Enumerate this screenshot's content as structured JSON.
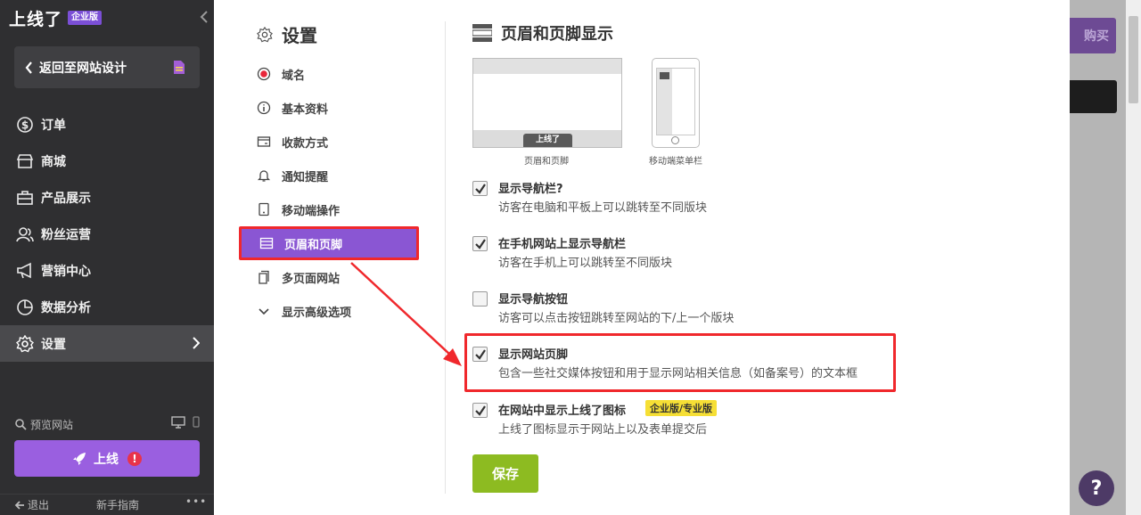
{
  "sidebar": {
    "logo": "上线了",
    "edition_badge": "企业版",
    "back_label": "返回至网站设计",
    "items": [
      {
        "label": "订单",
        "icon": "dollar-circle-icon"
      },
      {
        "label": "商城",
        "icon": "store-icon"
      },
      {
        "label": "产品展示",
        "icon": "briefcase-icon"
      },
      {
        "label": "粉丝运营",
        "icon": "users-icon"
      },
      {
        "label": "营销中心",
        "icon": "megaphone-icon"
      },
      {
        "label": "数据分析",
        "icon": "pie-chart-icon"
      },
      {
        "label": "设置",
        "icon": "gear-icon"
      }
    ],
    "active_item": "设置",
    "preview_label": "预览网站",
    "publish_label": "上线",
    "publish_warning": "!",
    "logout_label": "退出",
    "guide_label": "新手指南",
    "more_label": "•••"
  },
  "background": {
    "buy_label": "购买",
    "help_label": "?"
  },
  "settings": {
    "title": "设置",
    "menu": [
      {
        "label": "域名",
        "icon": "record-icon"
      },
      {
        "label": "基本资料",
        "icon": "info-icon"
      },
      {
        "label": "收款方式",
        "icon": "card-icon"
      },
      {
        "label": "通知提醒",
        "icon": "bell-icon"
      },
      {
        "label": "移动端操作",
        "icon": "mobile-icon"
      },
      {
        "label": "页眉和页脚",
        "icon": "header-footer-icon"
      },
      {
        "label": "多页面网站",
        "icon": "pages-icon"
      },
      {
        "label": "显示高级选项",
        "icon": "chevron-down-icon"
      }
    ],
    "active_menu": "页眉和页脚"
  },
  "content": {
    "title": "页眉和页脚显示",
    "thumb_desktop_caption": "页眉和页脚",
    "thumb_desktop_logo": "上线了",
    "thumb_mobile_caption": "移动端菜单栏",
    "options": [
      {
        "title": "显示导航栏?",
        "desc": "访客在电脑和平板上可以跳转至不同版块",
        "checked": true
      },
      {
        "title": "在手机网站上显示导航栏",
        "desc": "访客在手机上可以跳转至不同版块",
        "checked": true
      },
      {
        "title": "显示导航按钮",
        "desc": "访客可以点击按钮跳转至网站的下/上一个版块",
        "checked": false
      },
      {
        "title": "显示网站页脚",
        "desc": "包含一些社交媒体按钮和用于显示网站相关信息（如备案号）的文本框",
        "checked": true
      },
      {
        "title": "在网站中显示上线了图标",
        "desc": "上线了图标显示于网站上以及表单提交后",
        "checked": true,
        "badge": "企业版/专业版"
      }
    ],
    "save_label": "保存"
  },
  "colors": {
    "sidebar_bg": "#2f2f31",
    "accent_purple": "#8a56d3",
    "annotation_red": "#f0282c",
    "save_green": "#8dbb21",
    "badge_yellow": "#f6df35"
  }
}
